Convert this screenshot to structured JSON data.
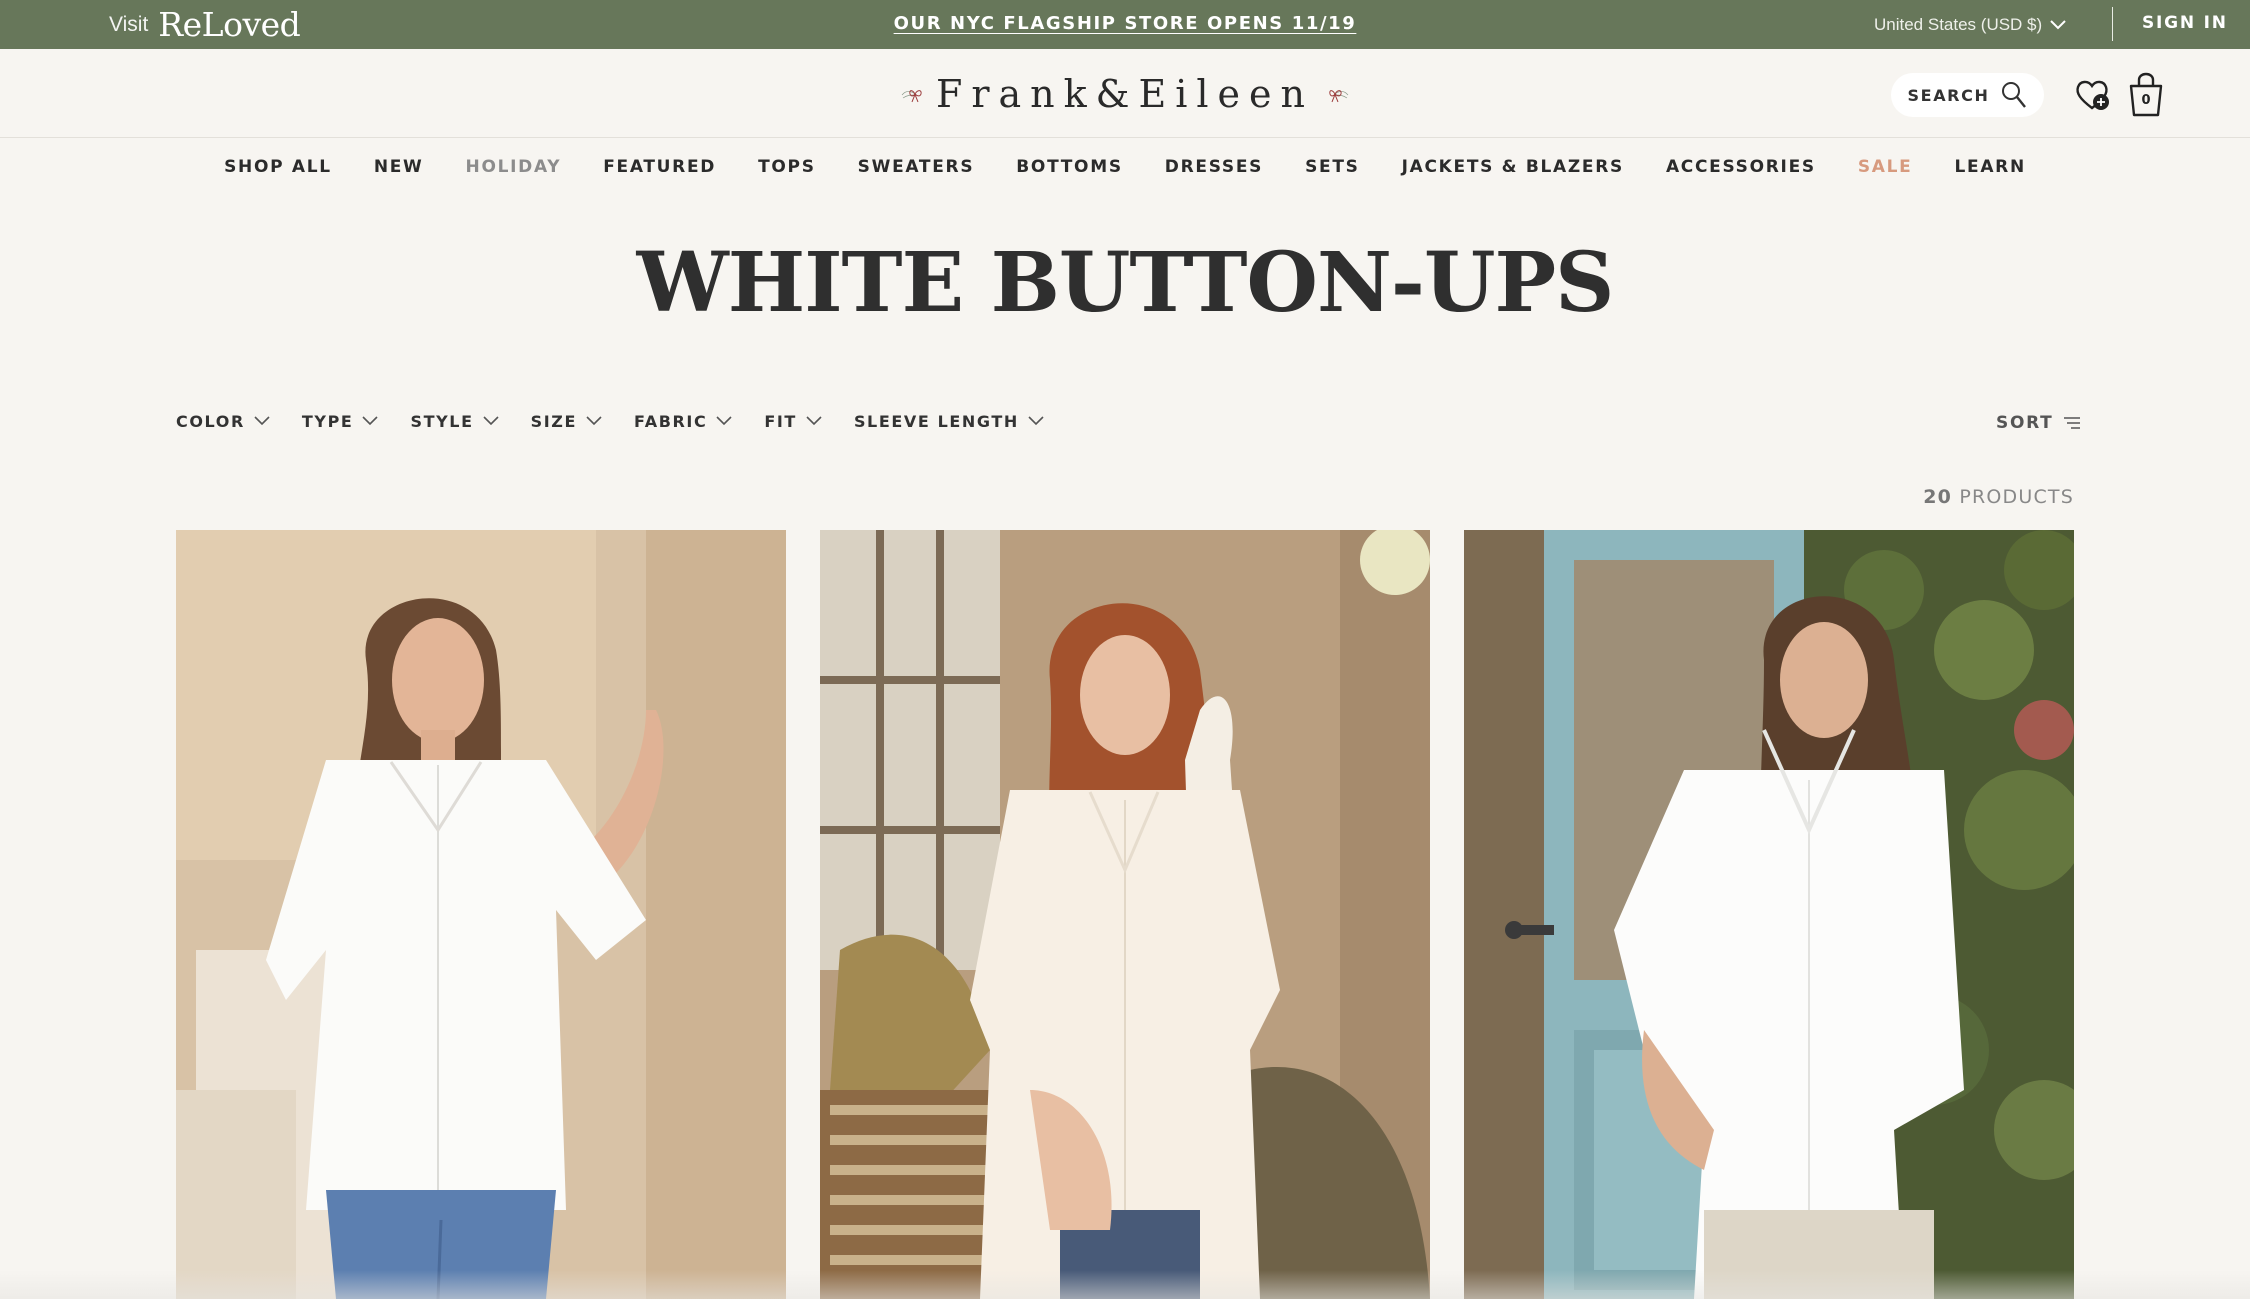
{
  "topbar": {
    "visit_label": "Visit",
    "reloved_brand": "ReLoved",
    "announcement": "OUR NYC FLAGSHIP STORE OPENS 11/19",
    "region": "United States (USD $)",
    "sign_in": "SIGN IN"
  },
  "header": {
    "logo_text": "Frank&Eileen",
    "search_label": "SEARCH",
    "cart_count": "0"
  },
  "nav": {
    "items": [
      "SHOP ALL",
      "NEW",
      "HOLIDAY",
      "FEATURED",
      "TOPS",
      "SWEATERS",
      "BOTTOMS",
      "DRESSES",
      "SETS",
      "JACKETS & BLAZERS",
      "ACCESSORIES",
      "SALE",
      "LEARN"
    ]
  },
  "page": {
    "title": "WHITE BUTTON-UPS",
    "product_count": "20",
    "product_count_suffix": "PRODUCTS"
  },
  "filters": {
    "items": [
      "COLOR",
      "TYPE",
      "STYLE",
      "SIZE",
      "FABRIC",
      "FIT",
      "SLEEVE LENGTH"
    ],
    "sort_label": "SORT"
  },
  "colors": {
    "topbar_bg": "#67775a",
    "page_bg": "#f7f5f1",
    "sale_accent": "#d79a7e",
    "logo_bow": "#9b3b3b"
  }
}
